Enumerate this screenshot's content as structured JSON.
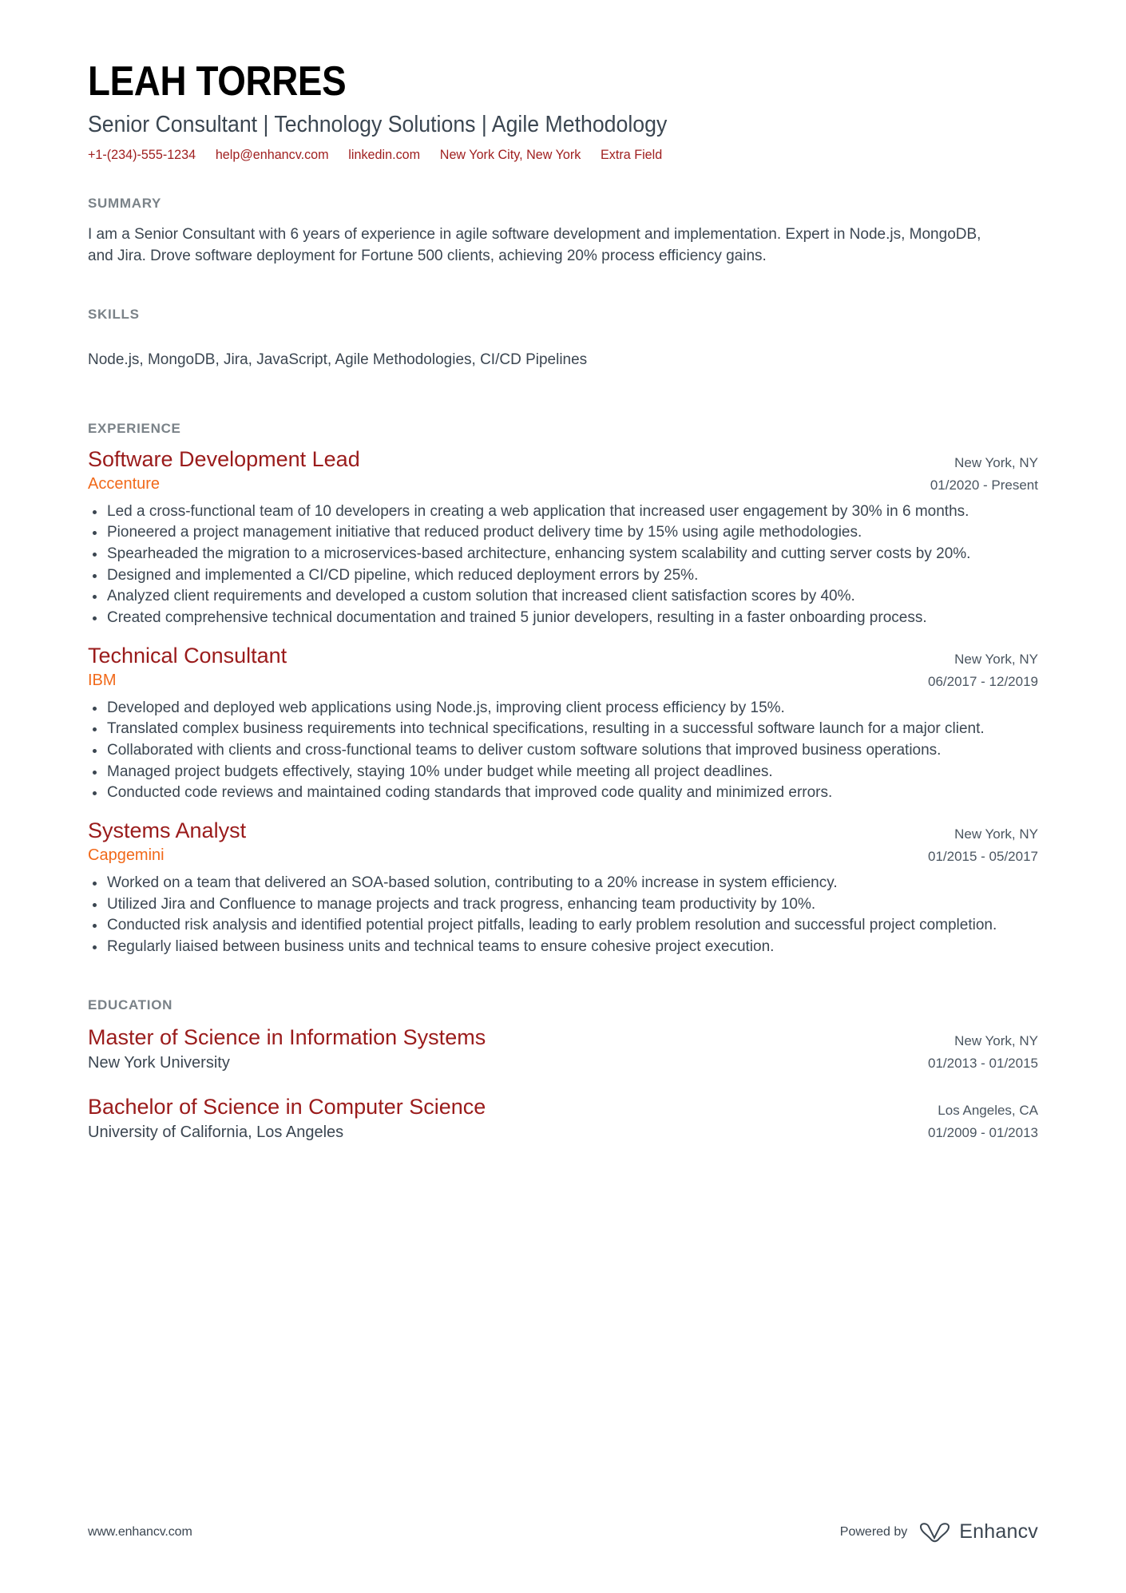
{
  "header": {
    "full_name": "LEAH TORRES",
    "job_title": "Senior Consultant | Technology Solutions | Agile Methodology",
    "contacts": [
      {
        "name": "phone",
        "value": "+1-(234)-555-1234"
      },
      {
        "name": "email",
        "value": "help@enhancv.com"
      },
      {
        "name": "linkedin",
        "value": "linkedin.com"
      },
      {
        "name": "location",
        "value": "New York City, New York"
      },
      {
        "name": "extra",
        "value": "Extra Field"
      }
    ],
    "accent_color": "#a02020"
  },
  "sections": {
    "summary": {
      "title": "SUMMARY",
      "text": "I am a Senior Consultant with 6 years of experience in agile software development and implementation. Expert in Node.js, MongoDB, and Jira. Drove software deployment for Fortune 500 clients, achieving 20% process efficiency gains."
    },
    "skills": {
      "title": "SKILLS",
      "text": "Node.js, MongoDB, Jira, JavaScript, Agile Methodologies, CI/CD Pipelines"
    },
    "experience": {
      "title": "EXPERIENCE",
      "entries": [
        {
          "title": "Software Development Lead",
          "organization": "Accenture",
          "location": "New York, NY",
          "dates": "01/2020 - Present",
          "bullets": [
            "Led a cross-functional team of 10 developers in creating a web application that increased user engagement by 30% in 6 months.",
            "Pioneered a project management initiative that reduced product delivery time by 15% using agile methodologies.",
            "Spearheaded the migration to a microservices-based architecture, enhancing system scalability and cutting server costs by 20%.",
            "Designed and implemented a CI/CD pipeline, which reduced deployment errors by 25%.",
            "Analyzed client requirements and developed a custom solution that increased client satisfaction scores by 40%.",
            "Created comprehensive technical documentation and trained 5 junior developers, resulting in a faster onboarding process."
          ]
        },
        {
          "title": "Technical Consultant",
          "organization": "IBM",
          "location": "New York, NY",
          "dates": "06/2017 - 12/2019",
          "bullets": [
            "Developed and deployed web applications using Node.js, improving client process efficiency by 15%.",
            "Translated complex business requirements into technical specifications, resulting in a successful software launch for a major client.",
            "Collaborated with clients and cross-functional teams to deliver custom software solutions that improved business operations.",
            "Managed project budgets effectively, staying 10% under budget while meeting all project deadlines.",
            "Conducted code reviews and maintained coding standards that improved code quality and minimized errors."
          ]
        },
        {
          "title": "Systems Analyst",
          "organization": "Capgemini",
          "location": "New York, NY",
          "dates": "01/2015 - 05/2017",
          "bullets": [
            "Worked on a team that delivered an SOA-based solution, contributing to a 20% increase in system efficiency.",
            "Utilized Jira and Confluence to manage projects and track progress, enhancing team productivity by 10%.",
            "Conducted risk analysis and identified potential project pitfalls, leading to early problem resolution and successful project completion.",
            "Regularly liaised between business units and technical teams to ensure cohesive project execution."
          ]
        }
      ]
    },
    "education": {
      "title": "EDUCATION",
      "entries": [
        {
          "degree": "Master of Science in Information Systems",
          "school": "New York University",
          "location": "New York, NY",
          "dates": "01/2013 - 01/2015"
        },
        {
          "degree": "Bachelor of Science in Computer Science",
          "school": "University of California, Los Angeles",
          "location": "Los Angeles, CA",
          "dates": "01/2009 - 01/2013"
        }
      ]
    }
  },
  "footer": {
    "url": "www.enhancv.com",
    "powered_by": "Powered by",
    "brand": "Enhancv"
  },
  "theme": {
    "title_color": "#9a1b1b",
    "org_color": "#f1691a",
    "section_heading_color": "#7a8288",
    "body_color": "#3b4651"
  }
}
